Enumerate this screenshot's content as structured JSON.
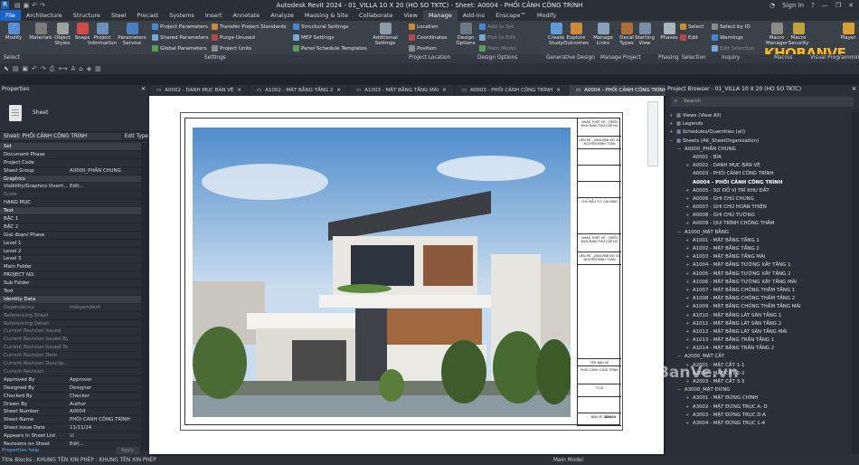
{
  "titlebar": {
    "logo": "R",
    "title": "Autodesk Revit 2024 - 01_VILLA 10 X 20 (HO SO TKTC) - Sheet: A0004 - PHỐI CẢNH CÔNG TRÌNH",
    "sign_in": "Sign In",
    "help": "?"
  },
  "tabs": [
    "File",
    "Architecture",
    "Structure",
    "Steel",
    "Precast",
    "Systems",
    "Insert",
    "Annotate",
    "Analyze",
    "Massing & Site",
    "Collaborate",
    "View",
    "Manage",
    "Add-Ins",
    "Enscape™",
    "Modify"
  ],
  "active_tab": "Manage",
  "ribbon": {
    "big": [
      {
        "label": "Modify"
      },
      {
        "label": "Materials"
      },
      {
        "label": "Object Styles"
      },
      {
        "label": "Snaps"
      },
      {
        "label": "Project Information"
      },
      {
        "label": "Parameters Service"
      },
      {
        "label": "Additional Settings"
      },
      {
        "label": "Design Options"
      },
      {
        "label": "Create Study"
      },
      {
        "label": "Explore Outcomes"
      },
      {
        "label": "Manage Links"
      },
      {
        "label": "Decal Types"
      },
      {
        "label": "Starting View"
      },
      {
        "label": "Phases"
      },
      {
        "label": "Macro Manager"
      },
      {
        "label": "Macro Security"
      },
      {
        "label": "Player"
      }
    ],
    "small": [
      {
        "label": "Project Parameters"
      },
      {
        "label": "Shared Parameters"
      },
      {
        "label": "Global Parameters"
      },
      {
        "label": "Transfer Project Standards"
      },
      {
        "label": "Purge Unused"
      },
      {
        "label": "Project Units"
      },
      {
        "label": "Structural Settings"
      },
      {
        "label": "MEP Settings"
      },
      {
        "label": "Panel Schedule Templates"
      },
      {
        "label": "Location"
      },
      {
        "label": "Coordinates"
      },
      {
        "label": "Position"
      },
      {
        "label": "Add to Set"
      },
      {
        "label": "Pick to Edit"
      },
      {
        "label": "Main Model"
      },
      {
        "label": "Select"
      },
      {
        "label": "Edit"
      },
      {
        "label": "Select by ID"
      },
      {
        "label": "Warnings"
      },
      {
        "label": "Edit Selection"
      }
    ],
    "groups": [
      "Select",
      "Settings",
      "Project Location",
      "Design Options",
      "Generative Design",
      "Manage Project",
      "Phasing",
      "Selection",
      "Inquiry",
      "Macros",
      "Visual Programming"
    ]
  },
  "properties": {
    "title": "Properties",
    "type_name": "Sheet",
    "selector": "Sheet: PHỐI CẢNH CÔNG TRÌNH",
    "edit_type": "Edit Type",
    "rows": [
      {
        "k": "Set",
        "v": "",
        "grp": true
      },
      {
        "k": "Document Phase",
        "v": ""
      },
      {
        "k": "Project Code",
        "v": ""
      },
      {
        "k": "Sheet Group",
        "v": "A0000_PHẦN CHUNG"
      },
      {
        "k": "Graphics",
        "v": "",
        "grp": true
      },
      {
        "k": "Visibility/Graphics Overri...",
        "v": "Edit..."
      },
      {
        "k": "Scale",
        "v": "",
        "dim": true
      },
      {
        "k": "HẠNG MỤC",
        "v": ""
      },
      {
        "k": "Text",
        "v": "",
        "grp": true
      },
      {
        "k": "BẬC 1",
        "v": ""
      },
      {
        "k": "BẬC 2",
        "v": ""
      },
      {
        "k": "Giai đoạn/ Phase",
        "v": ""
      },
      {
        "k": "Level 1",
        "v": ""
      },
      {
        "k": "Level 2",
        "v": ""
      },
      {
        "k": "Level 3",
        "v": ""
      },
      {
        "k": "Main Folder",
        "v": ""
      },
      {
        "k": "PROJECT NO.",
        "v": ""
      },
      {
        "k": "Sub Folder",
        "v": ""
      },
      {
        "k": "Text",
        "v": ""
      },
      {
        "k": "Identity Data",
        "v": "",
        "grp": true
      },
      {
        "k": "Dependency",
        "v": "Independent",
        "dim": true
      },
      {
        "k": "Referencing Sheet",
        "v": "",
        "dim": true
      },
      {
        "k": "Referencing Detail",
        "v": "",
        "dim": true
      },
      {
        "k": "Current Revision Issued",
        "v": "",
        "dim": true
      },
      {
        "k": "Current Revision Issued By",
        "v": "",
        "dim": true
      },
      {
        "k": "Current Revision Issued To",
        "v": "",
        "dim": true
      },
      {
        "k": "Current Revision Date",
        "v": "",
        "dim": true
      },
      {
        "k": "Current Revision Descrip...",
        "v": "",
        "dim": true
      },
      {
        "k": "Current Revision",
        "v": "",
        "dim": true
      },
      {
        "k": "Approved By",
        "v": "Approver"
      },
      {
        "k": "Designed By",
        "v": "Designer"
      },
      {
        "k": "Checked By",
        "v": "Checker"
      },
      {
        "k": "Drawn By",
        "v": "Author"
      },
      {
        "k": "Sheet Number",
        "v": "A0004"
      },
      {
        "k": "Sheet Name",
        "v": "PHỐI CẢNH CÔNG TRÌNH"
      },
      {
        "k": "Sheet Issue Date",
        "v": "11/11/24"
      },
      {
        "k": "Appears In Sheet List",
        "v": "☑"
      },
      {
        "k": "Revisions on Sheet",
        "v": "Edit..."
      }
    ],
    "help": "Properties help",
    "apply": "Apply"
  },
  "view_tabs": [
    {
      "label": "A0002 - DANH MỤC BẢN VẼ"
    },
    {
      "label": "A1002 - MẶT BẰNG TẦNG 2"
    },
    {
      "label": "A1003 - MẶT BẰNG TẦNG MÁI"
    },
    {
      "label": "A0003 - PHỐI CẢNH CÔNG TRÌNH"
    },
    {
      "label": "A0004 - PHỐI CẢNH CÔNG TRÌNH"
    }
  ],
  "titleblock": {
    "firm": "NHÂN THIẾT KẾ - TRIỂN KHAI ĐỊNH THỰ CẤP HỘ",
    "contact": "LIÊN HỆ : 0944.888.000 KS NGUYỄN MINH TOÀN",
    "owner": "CHỦ ĐẦU TƯ: GIA ĐÌNH",
    "firm2": "NHÂN THIẾT KẾ - TRIỂN KHAI ĐỊNH THỰ CẤP HỘ",
    "contact2": "LIÊN HỆ : 0944.888.000 KS NGUYỄN MINH TOÀN",
    "drawing_label": "TÊN BẢN VẼ",
    "drawing_name": "PHỐI CẢNH CÔNG TRÌNH",
    "scale": "TỈ LỆ",
    "sheet_label": "BẢN VẼ SỐ",
    "sheet_no": "A0004"
  },
  "browser": {
    "title": "Project Browser - 01_VILLA 10 X 20 (HO SO TKTC)",
    "search": "Search",
    "items": [
      {
        "t": "Views (View All)",
        "lvl": 0,
        "ex": "+"
      },
      {
        "t": "Legends",
        "lvl": 0,
        "ex": "+"
      },
      {
        "t": "Schedules/Quantities (all)",
        "lvl": 0,
        "ex": "+"
      },
      {
        "t": "Sheets (AK_SheetOrganization)",
        "lvl": 0,
        "ex": "−"
      },
      {
        "t": "A0000_PHẦN CHUNG",
        "lvl": 1,
        "ex": "−"
      },
      {
        "t": "A0001 - BÌA",
        "lvl": 2,
        "ex": ""
      },
      {
        "t": "A0002 - DANH MỤC BẢN VẼ",
        "lvl": 2,
        "ex": "+"
      },
      {
        "t": "A0003 - PHỐI CẢNH CÔNG TRÌNH",
        "lvl": 2,
        "ex": ""
      },
      {
        "t": "A0004 - PHỐI CẢNH CÔNG TRÌNH",
        "lvl": 2,
        "ex": "",
        "sel": true
      },
      {
        "t": "A0005 - SƠ ĐỒ VỊ TRÍ KHU ĐẤT",
        "lvl": 2,
        "ex": "+"
      },
      {
        "t": "A0006 - GHI CHÚ CHUNG",
        "lvl": 2,
        "ex": "+"
      },
      {
        "t": "A0007 - GHI CHÚ HOÀN THIỆN",
        "lvl": 2,
        "ex": "+"
      },
      {
        "t": "A0008 - GHI CHÚ TƯỜNG",
        "lvl": 2,
        "ex": "+"
      },
      {
        "t": "A0009 - QUI TRÌNH CHỐNG THẤM",
        "lvl": 2,
        "ex": "+"
      },
      {
        "t": "A1000_MẶT BẰNG",
        "lvl": 1,
        "ex": "−"
      },
      {
        "t": "A1001 - MẶT BẰNG TẦNG 1",
        "lvl": 2,
        "ex": "+"
      },
      {
        "t": "A1002 - MẶT BẰNG TẦNG 2",
        "lvl": 2,
        "ex": "+"
      },
      {
        "t": "A1003 - MẶT BẰNG TẦNG MÁI",
        "lvl": 2,
        "ex": "+"
      },
      {
        "t": "A1004 - MẶT BẰNG TƯỜNG XÂY TẦNG 1",
        "lvl": 2,
        "ex": "+"
      },
      {
        "t": "A1005 - MẶT BẰNG TƯỜNG XÂY TẦNG 2",
        "lvl": 2,
        "ex": "+"
      },
      {
        "t": "A1006 - MẶT BẰNG TƯỜNG XÂY TẦNG MÁI",
        "lvl": 2,
        "ex": "+"
      },
      {
        "t": "A1007 - MẶT BẰNG CHỐNG THẤM TẦNG 1",
        "lvl": 2,
        "ex": "+"
      },
      {
        "t": "A1008 - MẶT BẰNG CHỐNG THẤM TẦNG 2",
        "lvl": 2,
        "ex": "+"
      },
      {
        "t": "A1009 - MẶT BẰNG CHỐNG THẤM TẦNG MÁI",
        "lvl": 2,
        "ex": "+"
      },
      {
        "t": "A1010 - MẶT BẰNG LÁT SÀN TẦNG 1",
        "lvl": 2,
        "ex": "+"
      },
      {
        "t": "A1011 - MẶT BẰNG LÁT SÀN TẦNG 2",
        "lvl": 2,
        "ex": "+"
      },
      {
        "t": "A1012 - MẶT BẰNG LÁT SÀN TẦNG MÁI",
        "lvl": 2,
        "ex": "+"
      },
      {
        "t": "A1013 - MẶT BẰNG TRẦN TẦNG 1",
        "lvl": 2,
        "ex": "+"
      },
      {
        "t": "A1014 - MẶT BẰNG TRẦN TẦNG 2",
        "lvl": 2,
        "ex": "+"
      },
      {
        "t": "A2000_MẶT CẮT",
        "lvl": 1,
        "ex": "−"
      },
      {
        "t": "A2001 - MẶT CẮT 1-1",
        "lvl": 2,
        "ex": "+"
      },
      {
        "t": "A2002 - MẶT CẮT 2-2",
        "lvl": 2,
        "ex": "+"
      },
      {
        "t": "A2003 - MẶT CẮT 3-3",
        "lvl": 2,
        "ex": "+"
      },
      {
        "t": "A3000_MẶT ĐỨNG",
        "lvl": 1,
        "ex": "−"
      },
      {
        "t": "A3001 - MẶT ĐỨNG CHÍNH",
        "lvl": 2,
        "ex": "+"
      },
      {
        "t": "A3002 - MẶT ĐỨNG TRỤC A- D",
        "lvl": 2,
        "ex": "+"
      },
      {
        "t": "A3003 - MẶT ĐỨNG TRỤC D-A",
        "lvl": 2,
        "ex": "+"
      },
      {
        "t": "A3004 - MẶT ĐỨNG TRỤC 1-4",
        "lvl": 2,
        "ex": "+"
      }
    ]
  },
  "status": {
    "text": "Title Blocks : KHUNG TÊN XIN PHÉP : KHUNG TÊN XIN PHÉP",
    "model": "Main Model"
  },
  "watermarks": {
    "brand": "KHOBANVE",
    "center": "KhoBanVe.vn",
    "copyright": "Copyright © KhoBanVe.vn"
  },
  "colors": {
    "accent": "#1a63c9",
    "brand": "#ffb81c"
  }
}
